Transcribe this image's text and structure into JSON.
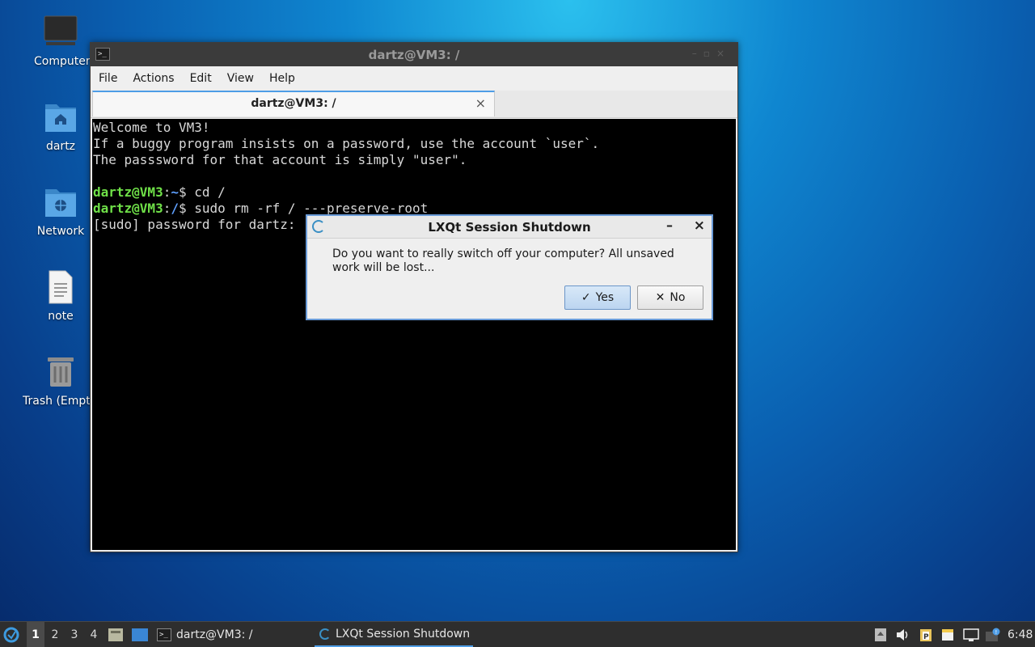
{
  "desktop": {
    "icons": [
      {
        "label": "Computer"
      },
      {
        "label": "dartz"
      },
      {
        "label": "Network"
      },
      {
        "label": "note"
      },
      {
        "label": "Trash (Empt"
      }
    ]
  },
  "terminal": {
    "window_title": "dartz@VM3: /",
    "menu": [
      "File",
      "Actions",
      "Edit",
      "View",
      "Help"
    ],
    "tab_label": "dartz@VM3: /",
    "lines": {
      "l1": "Welcome to VM3!",
      "l2": "If a buggy program insists on a password, use the account `user`.",
      "l3": "The passsword for that account is simply \"user\".",
      "p1_user": "dartz@VM3",
      "p1_path": "~",
      "p1_cmd": "$ cd /",
      "p2_user": "dartz@VM3",
      "p2_path": "/",
      "p2_cmd": "$ sudo rm -rf / ---preserve-root",
      "l6": "[sudo] password for dartz:"
    }
  },
  "dialog": {
    "title": "LXQt Session Shutdown",
    "message": "Do you want to really switch off your computer? All unsaved work will be lost...",
    "yes_label": "Yes",
    "no_label": "No"
  },
  "taskbar": {
    "workspaces": [
      "1",
      "2",
      "3",
      "4"
    ],
    "tasks": [
      {
        "label": "dartz@VM3: /"
      },
      {
        "label": "LXQt Session Shutdown"
      }
    ],
    "clock": "6:48"
  }
}
